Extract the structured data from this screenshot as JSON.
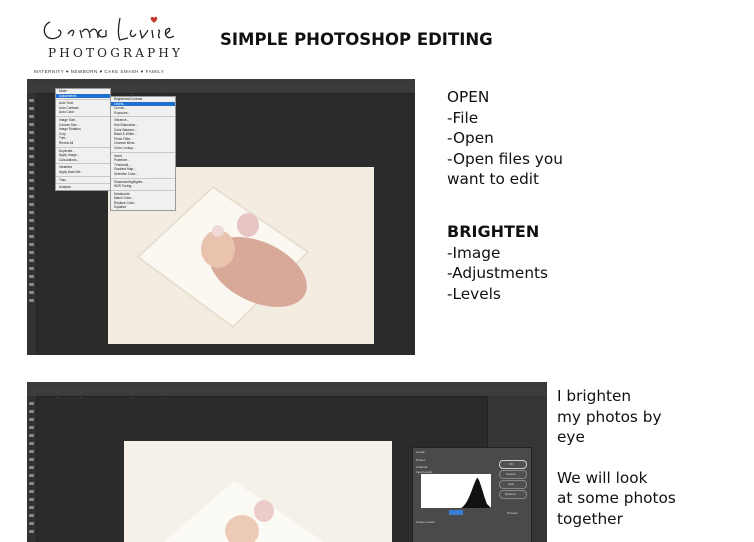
{
  "logo": {
    "script": "Gemma Louise",
    "photography": "PHOTOGRAPHY",
    "tagline": "MATERNITY ♥ NEWBORN ♥ CAKE SMASH ♥ FAMILY"
  },
  "title": "SIMPLE PHOTOSHOP EDITING",
  "open_block": [
    "OPEN",
    "-File",
    "-Open",
    "-Open files you",
    "want to edit"
  ],
  "brighten_block": {
    "heading": "BRIGHTEN",
    "lines": [
      "-Image",
      "-Adjustments",
      "-Levels"
    ]
  },
  "note_block": {
    "lines_a": [
      "I brighten",
      "my photos by",
      "eye"
    ],
    "lines_b": [
      "We will look",
      "at some photos",
      "together"
    ]
  },
  "screenshot1": {
    "menubar": [
      "File",
      "Edit",
      "Image",
      "Layer",
      "Type",
      "Select",
      "Filter",
      "View",
      "Plugins",
      "Window",
      "Help"
    ],
    "image_menu": [
      "Mode",
      "Adjustments",
      "Auto Tone",
      "Auto Contrast",
      "Auto Color",
      "Image Size...",
      "Canvas Size...",
      "Image Rotation",
      "Crop",
      "Trim...",
      "Reveal All",
      "Duplicate...",
      "Apply Image...",
      "Calculations...",
      "Variables",
      "Apply Data Set...",
      "Trap...",
      "Analysis"
    ],
    "adjust_menu": [
      "Brightness/Contrast...",
      "Levels...",
      "Curves...",
      "Exposure...",
      "Vibrance...",
      "Hue/Saturation...",
      "Color Balance...",
      "Black & White...",
      "Photo Filter...",
      "Channel Mixer...",
      "Color Lookup...",
      "Invert",
      "Posterize...",
      "Threshold...",
      "Gradient Map...",
      "Selective Color...",
      "Shadows/Highlights...",
      "HDR Toning...",
      "Desaturate",
      "Match Color...",
      "Replace Color...",
      "Equalize"
    ]
  },
  "screenshot2": {
    "menubar": [
      "File",
      "Edit",
      "Image",
      "Layer",
      "Type",
      "Select",
      "Filter",
      "View",
      "Plugins",
      "Window",
      "Help"
    ],
    "levels_dialog": {
      "title": "Levels",
      "preset": "Preset:",
      "channel": "Channel:",
      "input_levels": "Input Levels:",
      "output_levels": "Output Levels:",
      "buttons": [
        "OK",
        "Cancel",
        "Auto",
        "Options..."
      ],
      "preview": "Preview"
    }
  }
}
